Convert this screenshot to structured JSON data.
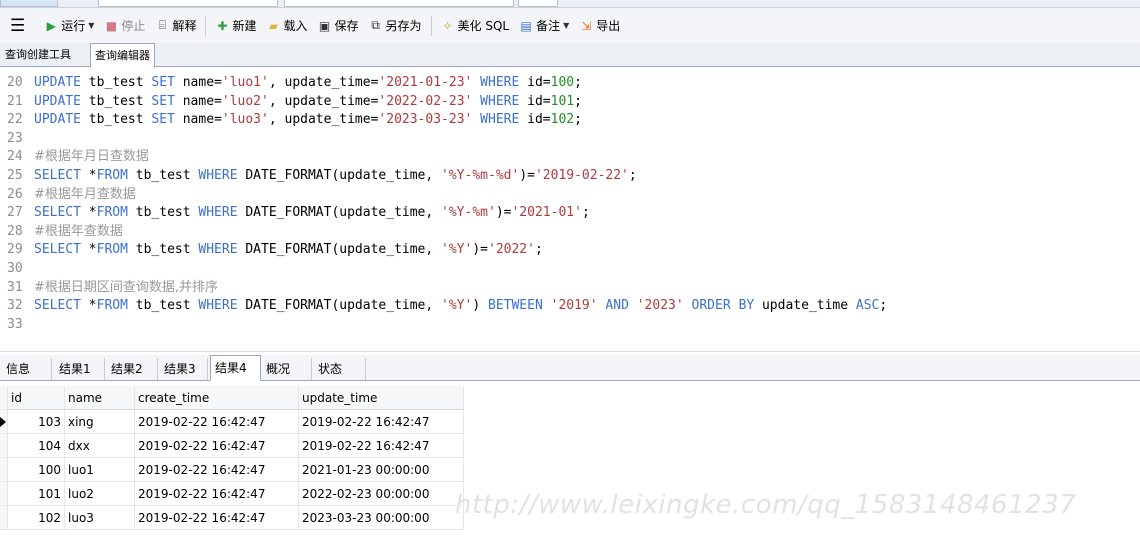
{
  "toolbar": {
    "menu_icon": "☰",
    "run_label": "运行",
    "stop_label": "停止",
    "explain_label": "解释",
    "new_label": "新建",
    "load_label": "载入",
    "save_label": "保存",
    "saveas_label": "另存为",
    "beautify_label": "美化 SQL",
    "note_label": "备注",
    "export_label": "导出",
    "icons": {
      "run": "play-icon",
      "stop": "stop-icon",
      "explain": "explain-icon",
      "new": "new-query-icon",
      "load": "folder-icon",
      "save": "save-icon",
      "saveas": "save-as-icon",
      "beautify": "beautify-icon",
      "note": "note-icon",
      "export": "export-icon"
    }
  },
  "subtabs": [
    "查询创建工具",
    "查询编辑器"
  ],
  "editor": {
    "lines": [
      {
        "n": "20",
        "type": "update",
        "name": "luo1",
        "time": "2021-01-23",
        "id": "100"
      },
      {
        "n": "21",
        "type": "update",
        "name": "luo2",
        "time": "2022-02-23",
        "id": "101"
      },
      {
        "n": "22",
        "type": "update",
        "name": "luo3",
        "time": "2023-03-23",
        "id": "102"
      },
      {
        "n": "23",
        "type": "blank"
      },
      {
        "n": "24",
        "type": "comment",
        "text": "#根据年月日查数据"
      },
      {
        "n": "25",
        "type": "select",
        "fmt": "'%Y-%m-%d'",
        "val": "'2019-02-22'"
      },
      {
        "n": "26",
        "type": "comment",
        "text": "#根据年月查数据"
      },
      {
        "n": "27",
        "type": "select",
        "fmt": "'%Y-%m'",
        "val": "'2021-01'"
      },
      {
        "n": "28",
        "type": "comment",
        "text": "#根据年查数据"
      },
      {
        "n": "29",
        "type": "select",
        "fmt": "'%Y'",
        "val": "'2022'"
      },
      {
        "n": "30",
        "type": "blank"
      },
      {
        "n": "31",
        "type": "comment",
        "text": "#根据日期区间查询数据,并排序"
      },
      {
        "n": "32",
        "type": "between",
        "fmt": "'%Y'",
        "lo": "'2019'",
        "hi": "'2023'"
      },
      {
        "n": "33",
        "type": "blank"
      }
    ]
  },
  "result_tabs": [
    "信息",
    "结果1",
    "结果2",
    "结果3",
    "结果4",
    "概况",
    "状态"
  ],
  "result_active": "结果4",
  "grid": {
    "columns": [
      "id",
      "name",
      "create_time",
      "update_time"
    ],
    "rows": [
      [
        "103",
        "xing",
        "2019-02-22 16:42:47",
        "2019-02-22 16:42:47"
      ],
      [
        "104",
        "dxx",
        "2019-02-22 16:42:47",
        "2019-02-22 16:42:47"
      ],
      [
        "100",
        "luo1",
        "2019-02-22 16:42:47",
        "2021-01-23 00:00:00"
      ],
      [
        "101",
        "luo2",
        "2019-02-22 16:42:47",
        "2022-02-23 00:00:00"
      ],
      [
        "102",
        "luo3",
        "2019-02-22 16:42:47",
        "2023-03-23 00:00:00"
      ]
    ]
  },
  "watermark": "http://www.leixingke.com/qq_1583148461237",
  "colors": {
    "keyword": "#3b6fd1",
    "string": "#b03a3a",
    "number": "#1f8f1f",
    "comment": "#9a9a9a"
  }
}
